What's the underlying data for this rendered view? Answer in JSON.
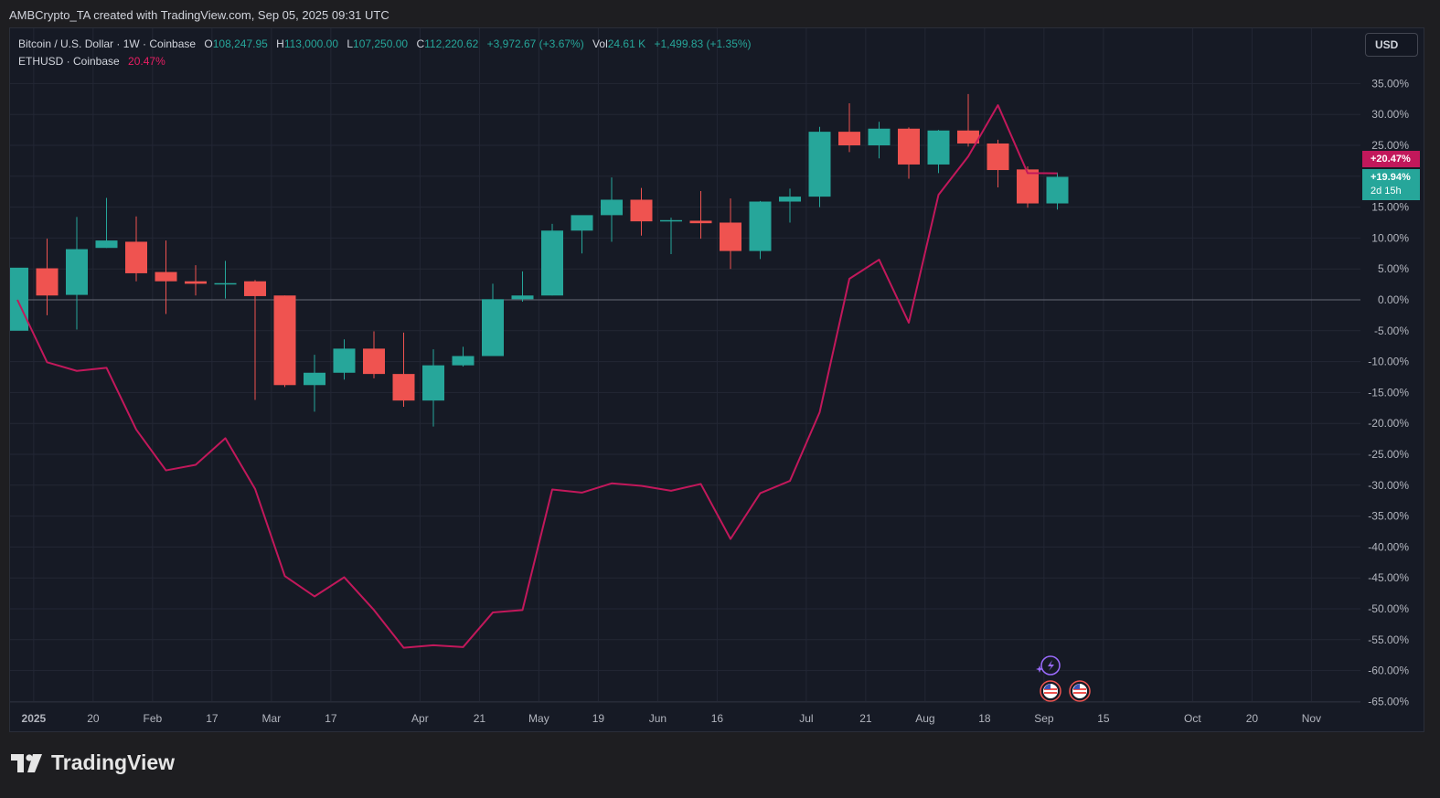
{
  "header": {
    "caption": "AMBCrypto_TA created with TradingView.com, Sep 05, 2025 09:31 UTC"
  },
  "legend": {
    "symbol": "Bitcoin / U.S. Dollar · 1W · Coinbase",
    "o_label": "O",
    "o": "108,247.95",
    "h_label": "H",
    "h": "113,000.00",
    "l_label": "L",
    "l": "107,250.00",
    "c_label": "C",
    "c": "112,220.62",
    "change": "+3,972.67 (+3.67%)",
    "vol_label": "Vol",
    "vol": "24.61 K",
    "vol_change": "+1,499.83 (+1.35%)",
    "compare_symbol": "ETHUSD · Coinbase",
    "compare_value": "20.47%"
  },
  "toolbar": {
    "currency": "USD"
  },
  "price_tags": {
    "eth": "+20.47%",
    "btc": "+19.94%",
    "countdown": "2d 15h"
  },
  "footer": {
    "logo_text": "TradingView"
  },
  "colors": {
    "background": "#161a25",
    "up": "#26a69a",
    "down": "#ef5350",
    "compare_line": "#c2185b",
    "grid": "#232735",
    "text": "#b2b5be"
  },
  "chart_data": {
    "type": "candlestick",
    "percent_scale": true,
    "ylim": [
      -65,
      37
    ],
    "y_ticks": [
      "35.00%",
      "30.00%",
      "25.00%",
      "20.00%",
      "15.00%",
      "10.00%",
      "5.00%",
      "0.00%",
      "-5.00%",
      "-10.00%",
      "-15.00%",
      "-20.00%",
      "-25.00%",
      "-30.00%",
      "-35.00%",
      "-40.00%",
      "-45.00%",
      "-50.00%",
      "-55.00%",
      "-60.00%",
      "-65.00%"
    ],
    "x_ticks": [
      {
        "label": "2025",
        "week": 0.55,
        "bold": true
      },
      {
        "label": "20",
        "week": 2.55
      },
      {
        "label": "Feb",
        "week": 4.55
      },
      {
        "label": "17",
        "week": 6.55
      },
      {
        "label": "Mar",
        "week": 8.55
      },
      {
        "label": "17",
        "week": 10.55
      },
      {
        "label": "Apr",
        "week": 13.55
      },
      {
        "label": "21",
        "week": 15.55
      },
      {
        "label": "May",
        "week": 17.55
      },
      {
        "label": "19",
        "week": 19.55
      },
      {
        "label": "Jun",
        "week": 21.55
      },
      {
        "label": "16",
        "week": 23.55
      },
      {
        "label": "Jul",
        "week": 26.55
      },
      {
        "label": "21",
        "week": 28.55
      },
      {
        "label": "Aug",
        "week": 30.55
      },
      {
        "label": "18",
        "week": 32.55
      },
      {
        "label": "Sep",
        "week": 34.55
      },
      {
        "label": "15",
        "week": 36.55
      },
      {
        "label": "Oct",
        "week": 39.55
      },
      {
        "label": "20",
        "week": 41.55
      },
      {
        "label": "Nov",
        "week": 43.55
      }
    ],
    "series": [
      {
        "name": "Bitcoin / U.S. Dollar",
        "type": "candlestick",
        "candles": [
          {
            "o": -5.0,
            "h": -0.5,
            "l": -2.3,
            "c": 5.2
          },
          {
            "o": 5.1,
            "h": 9.9,
            "l": -2.5,
            "c": 0.7
          },
          {
            "o": 0.8,
            "h": 13.4,
            "l": -4.8,
            "c": 8.2
          },
          {
            "o": 8.4,
            "h": 16.5,
            "l": 8.4,
            "c": 9.6
          },
          {
            "o": 9.4,
            "h": 13.5,
            "l": 3.0,
            "c": 4.3
          },
          {
            "o": 4.5,
            "h": 9.6,
            "l": -2.3,
            "c": 3.0
          },
          {
            "o": 3.0,
            "h": 5.6,
            "l": 0.7,
            "c": 2.6
          },
          {
            "o": 2.6,
            "h": 6.3,
            "l": 0.2,
            "c": 2.7
          },
          {
            "o": 3.0,
            "h": 3.2,
            "l": -16.2,
            "c": 0.6
          },
          {
            "o": 0.7,
            "h": 0.7,
            "l": -14.1,
            "c": -13.8
          },
          {
            "o": -13.8,
            "h": -8.9,
            "l": -18.1,
            "c": -11.8
          },
          {
            "o": -11.8,
            "h": -6.4,
            "l": -12.9,
            "c": -7.9
          },
          {
            "o": -7.9,
            "h": -5.1,
            "l": -12.7,
            "c": -12.0
          },
          {
            "o": -12.0,
            "h": -5.3,
            "l": -17.3,
            "c": -16.3
          },
          {
            "o": -16.3,
            "h": -8.0,
            "l": -20.5,
            "c": -10.6
          },
          {
            "o": -10.6,
            "h": -7.6,
            "l": -10.8,
            "c": -9.1
          },
          {
            "o": -9.1,
            "h": 2.6,
            "l": -9.1,
            "c": 0.1
          },
          {
            "o": 0.1,
            "h": 4.6,
            "l": -0.3,
            "c": 0.7
          },
          {
            "o": 0.7,
            "h": 12.3,
            "l": 0.7,
            "c": 11.2
          },
          {
            "o": 11.2,
            "h": 13.6,
            "l": 7.5,
            "c": 13.7
          },
          {
            "o": 13.7,
            "h": 19.8,
            "l": 9.4,
            "c": 16.2
          },
          {
            "o": 16.2,
            "h": 18.1,
            "l": 10.4,
            "c": 12.7
          },
          {
            "o": 12.8,
            "h": 13.3,
            "l": 7.4,
            "c": 12.9
          },
          {
            "o": 12.8,
            "h": 17.6,
            "l": 9.9,
            "c": 12.4
          },
          {
            "o": 12.5,
            "h": 16.4,
            "l": 5.0,
            "c": 7.9
          },
          {
            "o": 7.9,
            "h": 16.0,
            "l": 6.6,
            "c": 15.9
          },
          {
            "o": 15.9,
            "h": 18.0,
            "l": 12.5,
            "c": 16.7
          },
          {
            "o": 16.7,
            "h": 28.0,
            "l": 15.0,
            "c": 27.2
          },
          {
            "o": 27.2,
            "h": 31.8,
            "l": 23.9,
            "c": 25.0
          },
          {
            "o": 25.0,
            "h": 28.8,
            "l": 22.9,
            "c": 27.7
          },
          {
            "o": 27.7,
            "h": 27.9,
            "l": 19.6,
            "c": 21.9
          },
          {
            "o": 21.9,
            "h": 27.5,
            "l": 20.5,
            "c": 27.4
          },
          {
            "o": 27.4,
            "h": 33.3,
            "l": 24.8,
            "c": 25.3
          },
          {
            "o": 25.3,
            "h": 25.9,
            "l": 18.2,
            "c": 21.0
          },
          {
            "o": 21.1,
            "h": 21.6,
            "l": 14.9,
            "c": 15.6
          },
          {
            "o": 15.6,
            "h": 20.6,
            "l": 14.6,
            "c": 19.9
          }
        ]
      },
      {
        "name": "ETHUSD",
        "type": "line",
        "values": [
          0.0,
          -10.1,
          -11.5,
          -11.0,
          -21.0,
          -27.6,
          -26.7,
          -22.4,
          -30.6,
          -44.7,
          -48.0,
          -44.9,
          -50.2,
          -56.3,
          -55.9,
          -56.2,
          -50.6,
          -50.2,
          -30.7,
          -31.2,
          -29.7,
          -30.1,
          -30.9,
          -29.8,
          -38.7,
          -31.3,
          -29.3,
          -18.2,
          3.4,
          6.5,
          -3.7,
          17.0,
          23.2,
          31.5,
          20.5,
          20.47
        ]
      }
    ]
  }
}
